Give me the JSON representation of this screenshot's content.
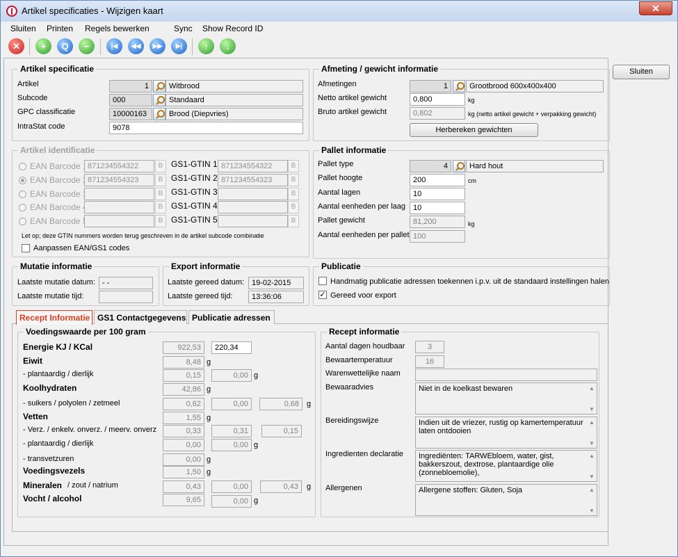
{
  "window": {
    "title": "Artikel specificaties - Wijzigen kaart",
    "close": "✕"
  },
  "menu": {
    "sluiten": "Sluiten",
    "printen": "Printen",
    "regels": "Regels bewerken",
    "sync": "Sync",
    "show": "Show Record ID"
  },
  "toolbar": {
    "delete": "✕",
    "add": "+",
    "search": "Q",
    "remove": "−",
    "first": "|◀",
    "prev": "◀◀",
    "next": "▶▶",
    "last": "▶|",
    "up": "↑",
    "down": "↓"
  },
  "side": {
    "sluiten": "Sluiten"
  },
  "artikel_spec": {
    "title": "Artikel specificatie",
    "artikel_label": "Artikel",
    "artikel_nr": "1",
    "artikel_name": "Witbrood",
    "subcode_label": "Subcode",
    "subcode_nr": "000",
    "subcode_name": "Standaard",
    "gpc_label": "GPC classificatie",
    "gpc_nr": "10000163",
    "gpc_name": "Brood (Diepvries)",
    "intrastat_label": "IntraStat code",
    "intrastat_value": "9078"
  },
  "afmeting": {
    "title": "Afmeting / gewicht informatie",
    "afm_label": "Afmetingen",
    "afm_nr": "1",
    "afm_name": "Grootbrood 600x400x400",
    "netto_label": "Netto artikel gewicht",
    "netto_value": "0,800",
    "netto_unit": "kg",
    "bruto_label": "Bruto artikel gewicht",
    "bruto_value": "0,802",
    "bruto_unit": "kg (netto artikel gewicht + verpakking gewicht)",
    "herbereken": "Herbereken gewichten"
  },
  "identificatie": {
    "title": "Artikel identificatie",
    "ean": [
      {
        "label": "EAN Barcode 1",
        "value": "871234554322"
      },
      {
        "label": "EAN Barcode 2",
        "value": "871234554323"
      },
      {
        "label": "EAN Barcode 3",
        "value": ""
      },
      {
        "label": "EAN Barcode 4",
        "value": ""
      },
      {
        "label": "EAN Barcode 5",
        "value": ""
      }
    ],
    "gtin": [
      {
        "label": "GS1-GTIN 1",
        "value": "871234554322"
      },
      {
        "label": "GS1-GTIN 2",
        "value": "871234554323"
      },
      {
        "label": "GS1-GTIN 3",
        "value": ""
      },
      {
        "label": "GS1-GTIN 4",
        "value": ""
      },
      {
        "label": "GS1-GTIN 5",
        "value": ""
      }
    ],
    "b": "B",
    "note": "Let op; deze GTIN nummers worden terug geschreven in de artikel subcode combinatie",
    "aanpassen": "Aanpassen EAN/GS1 codes"
  },
  "pallet": {
    "title": "Pallet informatie",
    "type_label": "Pallet type",
    "type_nr": "4",
    "type_name": "Hard hout",
    "hoogte_label": "Pallet hoogte",
    "hoogte_value": "200",
    "hoogte_unit": "cm",
    "lagen_label": "Aantal lagen",
    "lagen_value": "10",
    "perlaag_label": "Aantal eenheden per laag",
    "perlaag_value": "10",
    "gewicht_label": "Pallet gewicht",
    "gewicht_value": "81,200",
    "gewicht_unit": "kg",
    "perpallet_label": "Aantal eenheden per pallet",
    "perpallet_value": "100"
  },
  "mutatie": {
    "title": "Mutatie informatie",
    "datum_label": "Laatste mutatie datum:",
    "datum_value": "- -",
    "tijd_label": "Laatste mutatie tijd:",
    "tijd_value": ""
  },
  "export": {
    "title": "Export informatie",
    "datum_label": "Laatste gereed datum:",
    "datum_value": "19-02-2015",
    "tijd_label": "Laatste gereed tijd:",
    "tijd_value": "13:36:06"
  },
  "publicatie": {
    "title": "Publicatie",
    "handmatig": "Handmatig publicatie adressen toekennen i.p.v. uit de standaard instellingen halen",
    "gereed": "Gereed voor export",
    "gereed_mark": "✓"
  },
  "tabs": {
    "recept": "Recept Informatie",
    "gs1": "GS1 Contactgegevens",
    "publicatie": "Publicatie adressen"
  },
  "voeding": {
    "title": "Voedingswaarde per 100 gram",
    "energie": "Energie KJ / KCal",
    "energie_kj": "922,53",
    "energie_kcal": "220,34",
    "eiwit": "Eiwit",
    "eiwit_v": "8,48",
    "plant1": "- plantaardig / dierlijk",
    "plant1_a": "0,15",
    "plant1_b": "0,00",
    "kh": "Koolhydraten",
    "kh_v": "42,86",
    "suikers": "- suikers / polyolen / zetmeel",
    "suikers_a": "0,62",
    "suikers_b": "0,00",
    "suikers_c": "0,68",
    "vetten": "Vetten",
    "vetten_v": "1,55",
    "verz": "- Verz. / enkelv. onverz. / meerv. onverz",
    "verz_a": "0,33",
    "verz_b": "0,31",
    "verz_c": "0,15",
    "plant2": "- plantaardig / dierlijk",
    "plant2_a": "0,00",
    "plant2_b": "0,00",
    "trans": "- transvetzuren",
    "trans_v": "0,00",
    "vezels": "Voedingsvezels",
    "vezels_v": "1,50",
    "mineralen": "Mineralen",
    "mineralen_sub": "/ zout / natrium",
    "mineralen_a": "0,43",
    "mineralen_b": "0,00",
    "mineralen_c": "0,43",
    "vocht": "Vocht / alcohol",
    "vocht_a": "9,65",
    "vocht_b": "0,00",
    "g": "g"
  },
  "recept": {
    "title": "Recept informatie",
    "houdbaar_label": "Aantal dagen houdbaar",
    "houdbaar_value": "3",
    "bewaartemp_label": "Bewaartemperatuur",
    "bewaartemp_value": "16",
    "waren_label": "Warenwettelijke naam",
    "waren_value": "",
    "advies_label": "Bewaaradvies",
    "advies_value": "Niet in de koelkast bewaren",
    "bereiding_label": "Bereidingswijze",
    "bereiding_value": "Indien uit de vriezer, rustig op kamertemperatuur laten ontdooien",
    "ingred_label": "Ingredienten declaratie",
    "ingred_value": "Ingrediënten: TARWEbloem, water, gist, bakkerszout, dextrose, plantaardige olie (zonnebloemolie),",
    "allerg_label": "Allergenen",
    "allerg_value": "Allergene stoffen: Gluten, Soja",
    "scroll_up": "▲",
    "scroll_down": "▼"
  }
}
